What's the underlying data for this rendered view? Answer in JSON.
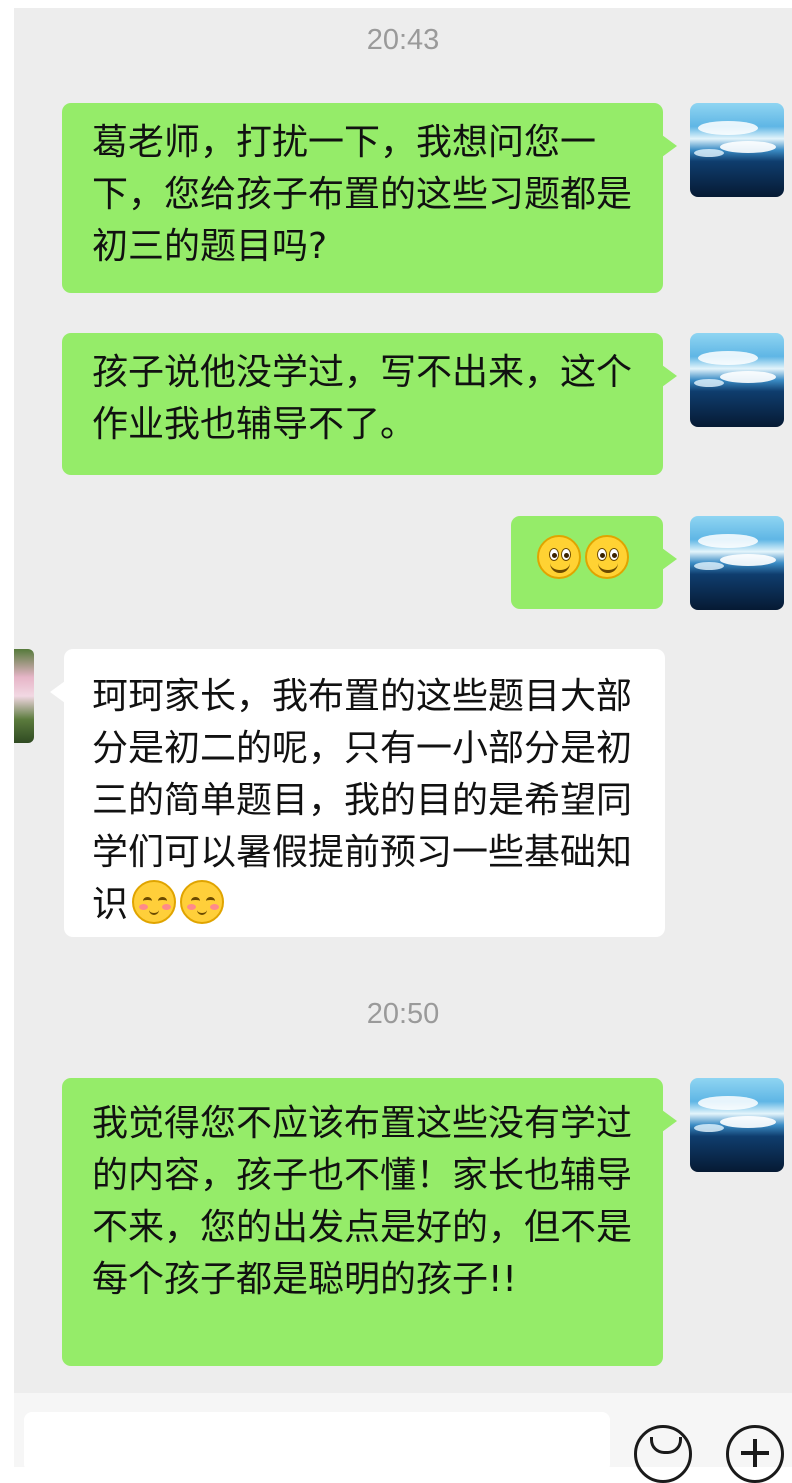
{
  "timestamps": [
    "20:43",
    "20:50"
  ],
  "messages": [
    {
      "from": "me",
      "text": "葛老师，打扰一下，我想问您一下，您给孩子布置的这些习题都是初三的题目吗?"
    },
    {
      "from": "me",
      "text": "孩子说他没学过，写不出来，这个作业我也辅导不了。"
    },
    {
      "from": "me",
      "emoji": [
        "smile-emoji",
        "smile-emoji"
      ]
    },
    {
      "from": "teacher",
      "text": "珂珂家长，我布置的这些题目大部分是初二的呢，只有一小部分是初三的简单题目，我的目的是希望同学们可以暑假提前预习一些基础知识",
      "emoji": [
        "blush-emoji",
        "blush-emoji"
      ]
    },
    {
      "from": "me",
      "text": "我觉得您不应该布置这些没有学过的内容，孩子也不懂！家长也辅导不来，您的出发点是好的，但不是每个孩子都是聪明的孩子!!"
    }
  ],
  "input_bar": {
    "icons": [
      "emoji-icon",
      "plus-icon"
    ]
  },
  "colors": {
    "sent_bubble": "#95ec69",
    "received_bubble": "#ffffff",
    "chat_bg": "#ededed"
  }
}
